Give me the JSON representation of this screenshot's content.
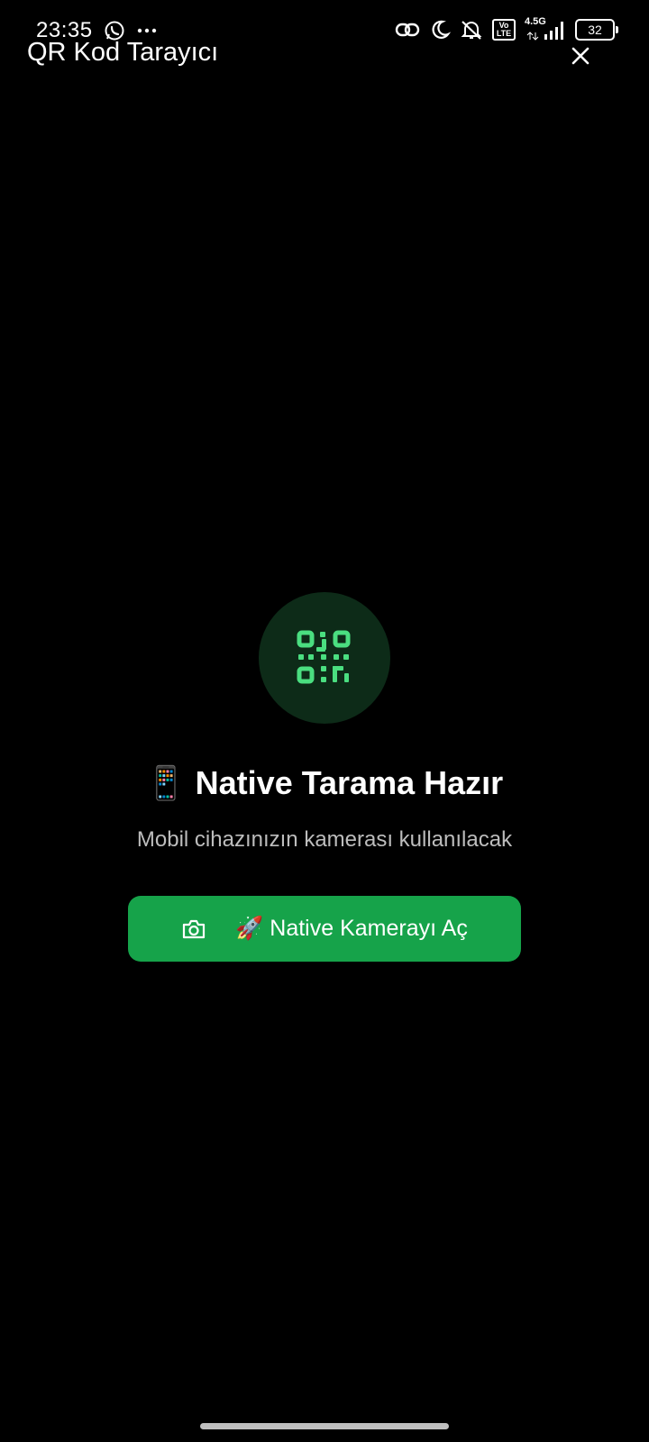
{
  "status_bar": {
    "time": "23:35",
    "network_type": "4.5G",
    "volte_label": "Vo LTE",
    "battery_level": "32",
    "icons": [
      "whatsapp-icon",
      "more-dots-icon",
      "link-icon",
      "moon-icon",
      "mute-icon",
      "volte-icon",
      "signal-icon",
      "battery-icon"
    ]
  },
  "header": {
    "title": "QR Kod Tarayıcı",
    "close_icon": "close-icon"
  },
  "main": {
    "qr_icon": "qr-code-icon",
    "heading_emoji": "📱",
    "heading": "Native Tarama Hazır",
    "subtitle": "Mobil cihazınızın kamerası kullanılacak",
    "button": {
      "icon": "camera-icon",
      "emoji": "🚀",
      "label": "Native Kamerayı Aç"
    }
  },
  "colors": {
    "background": "#000000",
    "accent": "#16a34a",
    "qr_circle": "#0d2b18",
    "qr_icon": "#4ade80"
  }
}
